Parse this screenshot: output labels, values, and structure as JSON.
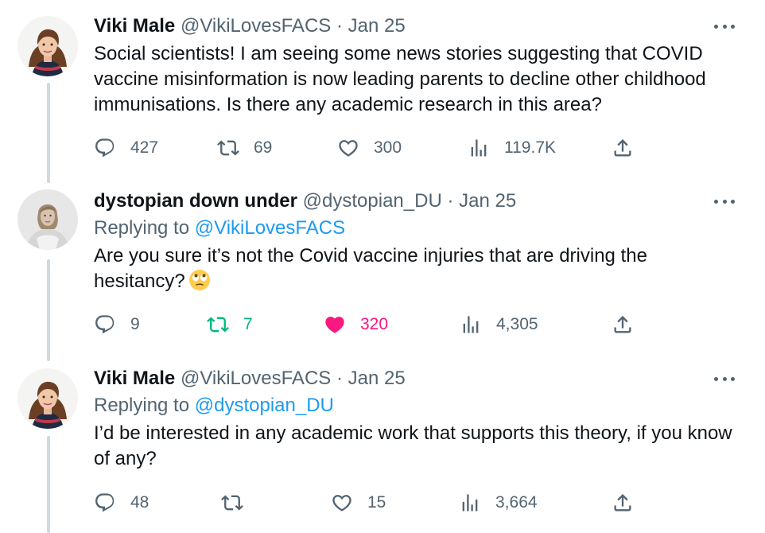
{
  "tweets": [
    {
      "name": "Viki Male",
      "handle": "@VikiLovesFACS",
      "date": "Jan 25",
      "reply_prefix": "",
      "reply_handle": "",
      "text": "Social scientists! I am seeing some news stories suggesting that COVID vaccine misinformation is now leading parents to decline other childhood immunisations. Is there any academic research in this area?",
      "replies": "427",
      "retweets": "69",
      "likes": "300",
      "views": "119.7K"
    },
    {
      "name": "dystopian down under",
      "handle": "@dystopian_DU",
      "date": "Jan 25",
      "reply_prefix": "Replying to",
      "reply_handle": "@VikiLovesFACS",
      "text": "Are you sure it’s not the Covid vaccine injuries that are driving the hesitancy?",
      "emoji": "face-with-rolling-eyes",
      "replies": "9",
      "retweets": "7",
      "likes": "320",
      "views": "4,305"
    },
    {
      "name": "Viki Male",
      "handle": "@VikiLovesFACS",
      "date": "Jan 25",
      "reply_prefix": "Replying to",
      "reply_handle": "@dystopian_DU",
      "text": "I’d be interested in any academic work that supports this theory, if you know of any?",
      "replies": "48",
      "retweets": "",
      "likes": "15",
      "views": "3,664"
    }
  ],
  "separator": " · ",
  "colors": {
    "link": "#1d9bf0",
    "muted": "#536471",
    "retweet_active": "#00ba7c",
    "like_active": "#f91880",
    "thread_line": "#cfd9de"
  },
  "icons": [
    "reply-icon",
    "retweet-icon",
    "like-icon",
    "views-icon",
    "share-icon",
    "more-icon"
  ]
}
